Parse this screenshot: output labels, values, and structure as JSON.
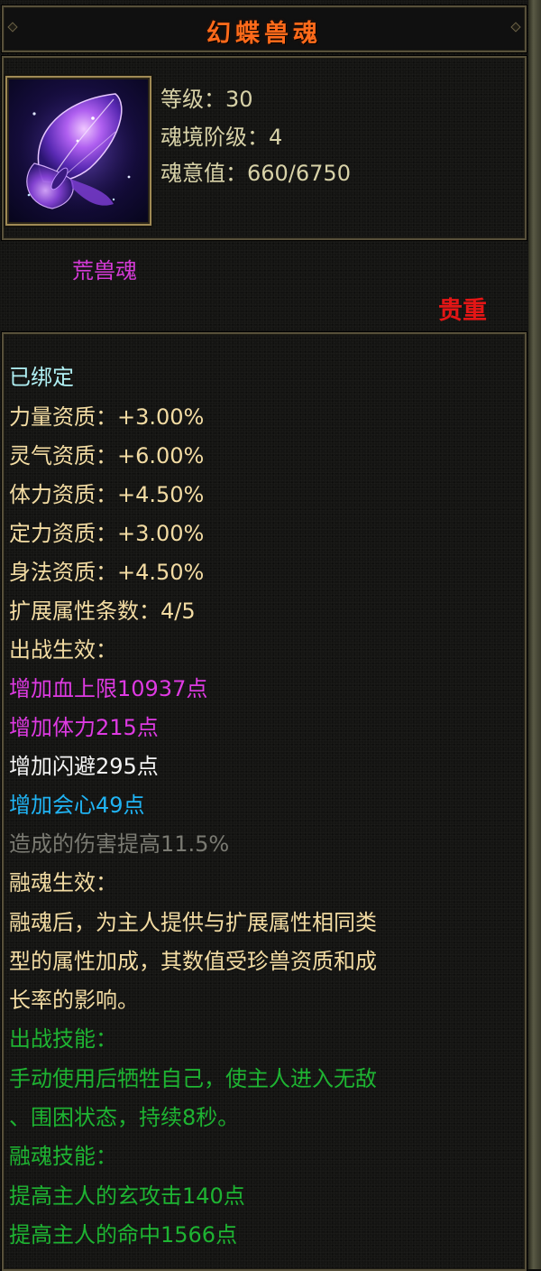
{
  "title": "幻蝶兽魂",
  "icon": "purple-butterfly-icon",
  "stats": {
    "level": "等级：30",
    "realm_rank": "魂境阶级：4",
    "soul_value": "魂意值：660/6750"
  },
  "type_label": "荒兽魂",
  "rarity": "贵重",
  "colors": {
    "title": "#ff6a1a",
    "bound": "#b0f0f4",
    "attribute": "#f3dca3",
    "magenta": "#de3ae2",
    "blue": "#20b4f4",
    "gray": "#7a7a72",
    "green": "#1eb432",
    "rarity": "#e41616"
  },
  "body": {
    "bound": "已绑定",
    "aptitudes": [
      "力量资质：+3.00%",
      "灵气资质：+6.00%",
      "体力资质：+4.50%",
      "定力资质：+3.00%",
      "身法资质：+4.50%"
    ],
    "ext_count": "扩展属性条数：4/5",
    "battle_effect_header": "出战生效：",
    "battle_effects": [
      "增加血上限10937点",
      "增加体力215点",
      "增加闪避295点",
      "增加会心49点",
      "造成的伤害提高11.5%"
    ],
    "fusion_effect_header": "融魂生效：",
    "fusion_desc": [
      "融魂后，为主人提供与扩展属性相同类",
      "型的属性加成，其数值受珍兽资质和成",
      "长率的影响。"
    ],
    "battle_skill_header": "出战技能：",
    "battle_skill_desc": [
      "手动使用后牺牲自己，使主人进入无敌",
      "、围困状态，持续8秒。"
    ],
    "fusion_skill_header": "融魂技能：",
    "fusion_skills": [
      "提高主人的玄攻击140点",
      "提高主人的命中1566点"
    ]
  }
}
